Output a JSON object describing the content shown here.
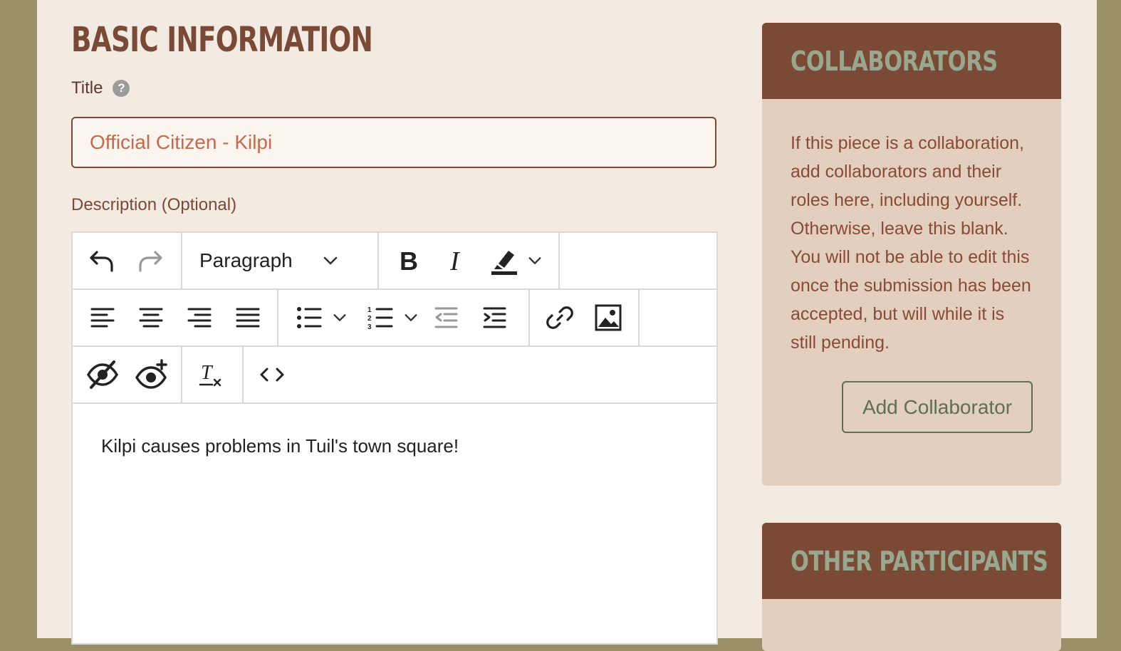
{
  "section_title": "BASIC INFORMATION",
  "title_field": {
    "label": "Title",
    "help_icon": "?",
    "value": "Official Citizen - Kilpi"
  },
  "description": {
    "label": "Description (Optional)",
    "format_select": "Paragraph",
    "content": "Kilpi causes problems in Tuil's town square!"
  },
  "collaborators": {
    "heading": "COLLABORATORS",
    "text": "If this piece is a collaboration, add collaborators and their roles here, including yourself. Otherwise, leave this blank. You will not be able to edit this once the submission has been accepted, but will while it is still pending.",
    "button": "Add Collaborator"
  },
  "other_participants": {
    "heading": "OTHER PARTICIPANTS"
  },
  "colors": {
    "brand_brown": "#7a4a36",
    "sage": "#98a88f",
    "panel_bg": "#e2cfbd",
    "page_bg": "#f3ebe2"
  }
}
